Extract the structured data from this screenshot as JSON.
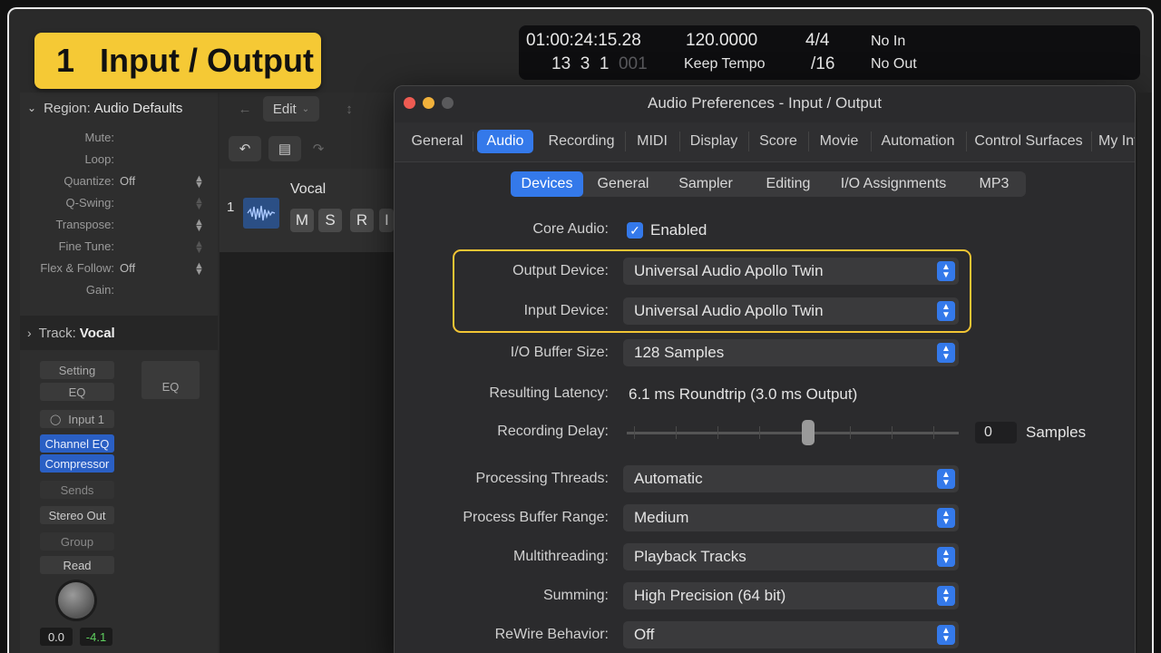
{
  "badge": {
    "number": "1",
    "title": "Input / Output"
  },
  "transport": {
    "time": "01:00:24:15.28",
    "bars": "13",
    "beats": "3",
    "div": "1",
    "ticks": "001",
    "tempo": "120.0000",
    "tempo_mode": "Keep Tempo",
    "signature": "4/4",
    "division": "/16",
    "midi_in": "No In",
    "midi_out": "No Out"
  },
  "inspector": {
    "region_label": "Region:",
    "region_name": "Audio Defaults",
    "rows": [
      {
        "label": "Mute:",
        "value": ""
      },
      {
        "label": "Loop:",
        "value": ""
      },
      {
        "label": "Quantize:",
        "value": "Off"
      },
      {
        "label": "Q-Swing:",
        "value": ""
      },
      {
        "label": "Transpose:",
        "value": ""
      },
      {
        "label": "Fine Tune:",
        "value": ""
      },
      {
        "label": "Flex & Follow:",
        "value": "Off"
      },
      {
        "label": "Gain:",
        "value": ""
      }
    ],
    "track_label": "Track:",
    "track_name": "Vocal",
    "strip": {
      "setting": "Setting",
      "eq": "EQ",
      "eq2": "EQ",
      "input": "Input 1",
      "plugin1": "Channel EQ",
      "plugin2": "Compressor",
      "sends": "Sends",
      "output": "Stereo Out",
      "group": "Group",
      "automation": "Read",
      "pan_value": "0.0",
      "volume_value": "-4.1"
    }
  },
  "tracks": {
    "edit_menu": "Edit",
    "track_number": "1",
    "track_name": "Vocal",
    "buttons": [
      "M",
      "S",
      "R",
      "I"
    ]
  },
  "prefs": {
    "title": "Audio Preferences - Input / Output",
    "tabs": [
      "General",
      "Audio",
      "Recording",
      "MIDI",
      "Display",
      "Score",
      "Movie",
      "Automation",
      "Control Surfaces",
      "My Info"
    ],
    "selected_tab": "Audio",
    "subtabs": [
      "Devices",
      "General",
      "Sampler",
      "Editing",
      "I/O Assignments",
      "MP3"
    ],
    "selected_subtab": "Devices",
    "core_audio_label": "Core Audio:",
    "core_audio_value": "Enabled",
    "output_device_label": "Output Device:",
    "output_device": "Universal Audio Apollo Twin",
    "input_device_label": "Input Device:",
    "input_device": "Universal Audio Apollo Twin",
    "buffer_label": "I/O Buffer Size:",
    "buffer_value": "128 Samples",
    "latency_label": "Resulting Latency:",
    "latency_value": "6.1 ms Roundtrip (3.0 ms Output)",
    "delay_label": "Recording Delay:",
    "delay_value": "0",
    "delay_unit": "Samples",
    "threads_label": "Processing Threads:",
    "threads_value": "Automatic",
    "range_label": "Process Buffer Range:",
    "range_value": "Medium",
    "multi_label": "Multithreading:",
    "multi_value": "Playback Tracks",
    "summing_label": "Summing:",
    "summing_value": "High Precision (64 bit)",
    "rewire_label": "ReWire Behavior:",
    "rewire_value": "Off"
  },
  "colors": {
    "accent": "#3479ea",
    "highlight": "#f2c534",
    "badge": "#f5c935"
  }
}
